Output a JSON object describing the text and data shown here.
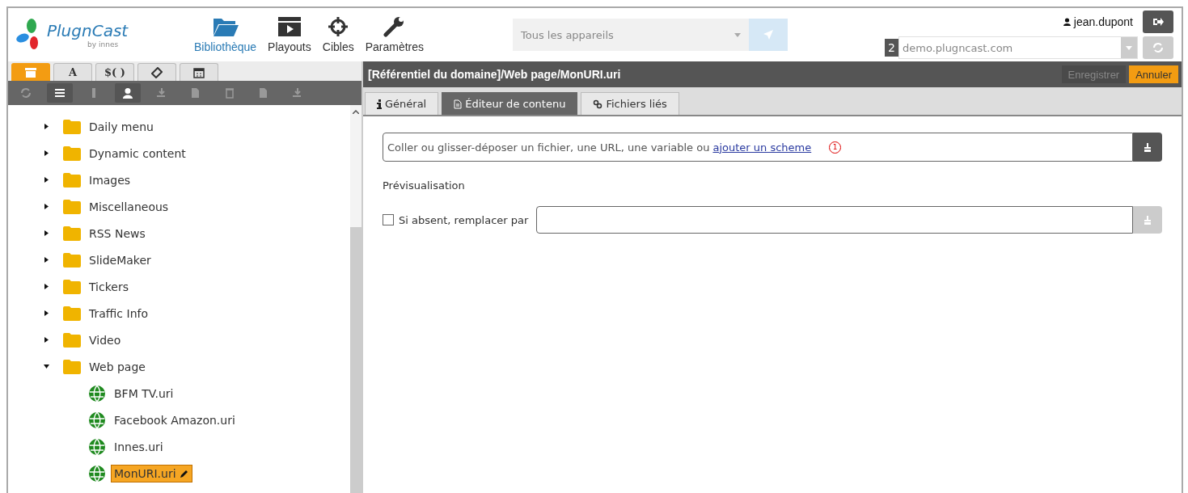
{
  "header": {
    "logo": {
      "name": "PlugnCast",
      "sub": "by innes"
    },
    "nav": [
      {
        "label": "Bibliothèque",
        "kind": "folder",
        "selected": true
      },
      {
        "label": "Playouts",
        "kind": "clapper",
        "selected": false
      },
      {
        "label": "Cibles",
        "kind": "target",
        "selected": false
      },
      {
        "label": "Paramètres",
        "kind": "wrench",
        "selected": false
      }
    ],
    "device_select": {
      "value": "Tous les appareils"
    },
    "user": "jean.dupont",
    "domain_count": "2",
    "domain": "demo.plugncast.com"
  },
  "left_tabs": [
    {
      "kind": "archive",
      "selected": true
    },
    {
      "kind": "text",
      "label": "A",
      "selected": false
    },
    {
      "kind": "text",
      "label": "$( )",
      "selected": false
    },
    {
      "kind": "tag",
      "selected": false
    },
    {
      "kind": "calendar",
      "selected": false
    }
  ],
  "toolbar": [
    {
      "kind": "refresh",
      "on": false
    },
    {
      "kind": "list",
      "on": true
    },
    {
      "kind": "traffic",
      "on": false
    },
    {
      "kind": "user",
      "on": true
    },
    {
      "kind": "download",
      "on": false
    },
    {
      "kind": "split",
      "on": false
    },
    {
      "kind": "trash",
      "on": false
    },
    {
      "kind": "file-menu",
      "on": false
    },
    {
      "kind": "upload-menu",
      "on": false
    }
  ],
  "tree": [
    {
      "label": "Daily menu",
      "expanded": false
    },
    {
      "label": "Dynamic content",
      "expanded": false
    },
    {
      "label": "Images",
      "expanded": false
    },
    {
      "label": "Miscellaneous",
      "expanded": false
    },
    {
      "label": "RSS News",
      "expanded": false
    },
    {
      "label": "SlideMaker",
      "expanded": false
    },
    {
      "label": "Tickers",
      "expanded": false
    },
    {
      "label": "Traffic Info",
      "expanded": false
    },
    {
      "label": "Video",
      "expanded": false
    },
    {
      "label": "Web page",
      "expanded": true,
      "children": [
        {
          "label": "BFM TV.uri",
          "selected": false
        },
        {
          "label": "Facebook Amazon.uri",
          "selected": false
        },
        {
          "label": "Innes.uri",
          "selected": false
        },
        {
          "label": "MonURI.uri",
          "selected": true
        }
      ]
    }
  ],
  "editor": {
    "path": "[Référentiel du domaine]/Web page/MonURI.uri",
    "save": "Enregistrer",
    "save_disabled": true,
    "cancel": "Annuler",
    "tabs": [
      {
        "label": "Général",
        "kind": "info",
        "selected": false
      },
      {
        "label": "Éditeur de contenu",
        "kind": "doc",
        "selected": true
      },
      {
        "label": "Fichiers liés",
        "kind": "link",
        "selected": false
      }
    ],
    "url_placeholder": "Coller ou glisser-déposer un fichier, une URL, une variable ou",
    "url_link": "ajouter un scheme",
    "marker": "1",
    "preview_label": "Prévisualisation",
    "fallback": {
      "label": "Si absent, remplacer par",
      "checked": false
    }
  }
}
